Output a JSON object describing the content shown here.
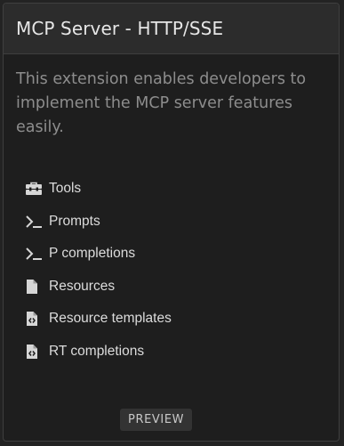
{
  "card": {
    "title": "MCP Server - HTTP/SSE",
    "description": "This extension enables developers to implement the MCP server features easily.",
    "features": [
      {
        "label": "Tools",
        "icon": "toolbox-icon"
      },
      {
        "label": "Prompts",
        "icon": "terminal-icon"
      },
      {
        "label": "P completions",
        "icon": "terminal-icon"
      },
      {
        "label": "Resources",
        "icon": "file-icon"
      },
      {
        "label": "Resource templates",
        "icon": "file-code-icon"
      },
      {
        "label": "RT completions",
        "icon": "file-code-icon"
      }
    ],
    "badge": "PREVIEW"
  },
  "colors": {
    "background": "#1e1e1e",
    "header": "#2c2c2c",
    "border": "#3f3f3f",
    "title_text": "#e6e6e6",
    "description_text": "#8d8d8d",
    "feature_text": "#dcdcdc",
    "badge_bg": "#333333"
  }
}
